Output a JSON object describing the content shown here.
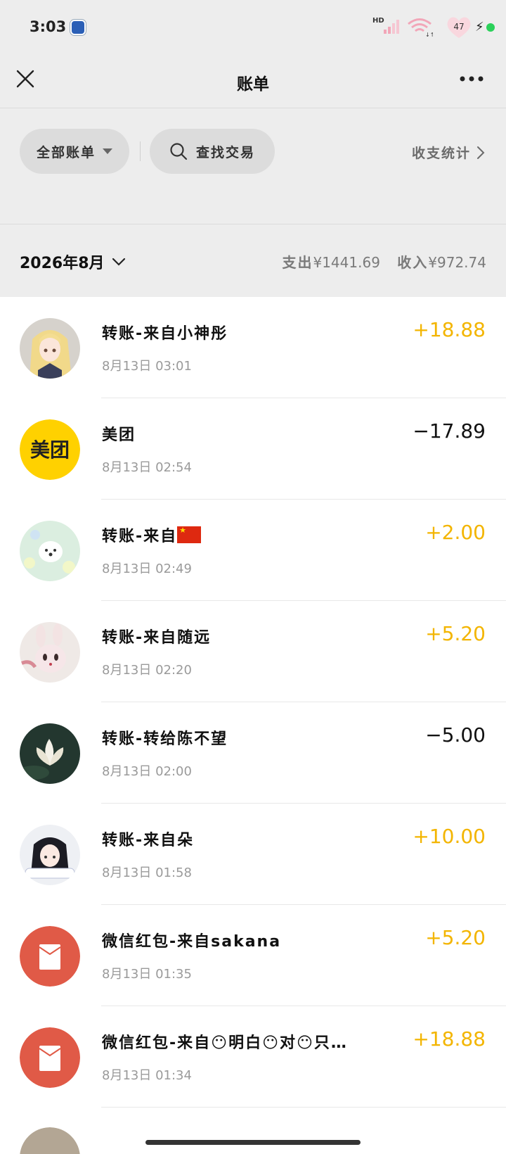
{
  "status_bar": {
    "time": "3:03",
    "signal_label": "HD",
    "battery": "47"
  },
  "nav": {
    "title": "账单",
    "close_icon": "close-icon",
    "more_icon": "more-icon"
  },
  "filters": {
    "all_bills": "全部账单",
    "search": "查找交易",
    "stats": "收支统计"
  },
  "month": {
    "label": "2026年8月",
    "expense_label": "支出",
    "expense_value": "¥1441.69",
    "income_label": "收入",
    "income_value": "¥972.74"
  },
  "colors": {
    "income": "#f3b500",
    "expense": "#111111",
    "meituan": "#ffd100",
    "red_packet": "#e05a47"
  },
  "transactions": [
    {
      "title": "转账-来自小神彤",
      "time": "8月13日 03:01",
      "amount": "+18.88",
      "type": "income",
      "avatar": "anime-girl-blonde-avatar"
    },
    {
      "title": "美团",
      "time": "8月13日 02:54",
      "amount": "−17.89",
      "type": "expense",
      "avatar": "meituan-logo",
      "logo_text": "美团"
    },
    {
      "title": "转账-来自",
      "time": "8月13日 02:49",
      "amount": "+2.00",
      "type": "income",
      "avatar": "puppy-flowers-avatar",
      "suffix_icon": "china-flag-icon"
    },
    {
      "title": "转账-来自随远",
      "time": "8月13日 02:20",
      "amount": "+5.20",
      "type": "income",
      "avatar": "bunny-avatar"
    },
    {
      "title": "转账-转给陈不望",
      "time": "8月13日 02:00",
      "amount": "−5.00",
      "type": "expense",
      "avatar": "lotus-avatar"
    },
    {
      "title": "转账-来自朵",
      "time": "8月13日 01:58",
      "amount": "+10.00",
      "type": "income",
      "avatar": "anime-girl-darkhair-avatar"
    },
    {
      "title": "微信红包-来自sakana",
      "time": "8月13日 01:35",
      "amount": "+5.20",
      "type": "income",
      "avatar": "red-packet-icon"
    },
    {
      "title": "微信红包-来自😶明白😶对😶只…",
      "time": "8月13日 01:34",
      "amount": "+18.88",
      "type": "income",
      "avatar": "red-packet-icon"
    }
  ]
}
